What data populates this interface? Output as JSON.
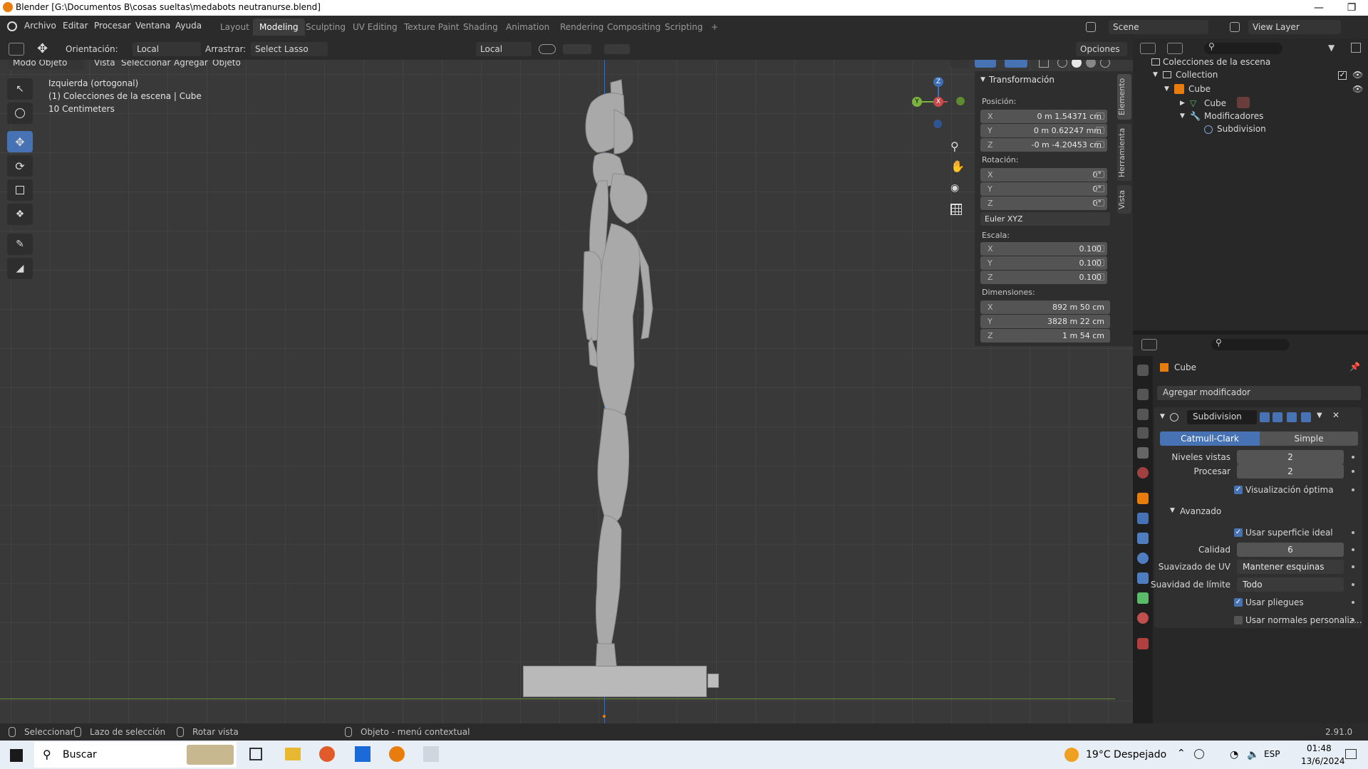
{
  "window": {
    "title": "Blender [G:\\Documentos B\\cosas sueltas\\medabots neutranurse.blend]",
    "minimize_icon": "minimize-icon",
    "maximize_icon": "restore-icon",
    "close_icon": "close-icon"
  },
  "menubar": {
    "items": [
      "Archivo",
      "Editar",
      "Procesar",
      "Ventana",
      "Ayuda"
    ],
    "workspaces": [
      "Layout",
      "Modeling",
      "Sculpting",
      "UV Editing",
      "Texture Paint",
      "Shading",
      "Animation",
      "Rendering",
      "Compositing",
      "Scripting"
    ],
    "active_workspace": "Modeling",
    "add_tab": "+",
    "scene": "Scene",
    "view_layer": "View Layer"
  },
  "tool_header": {
    "orientation_label": "Orientación:",
    "orientation_value": "Local",
    "drag_label": "Arrastrar:",
    "drag_value": "Select Lasso",
    "transform_pivot": "Local",
    "options": "Opciones"
  },
  "viewport_header": {
    "mode": "Modo Objeto",
    "items": [
      "Vista",
      "Seleccionar",
      "Agregar",
      "Objeto"
    ]
  },
  "viewport": {
    "view_name": "Izquierda (ortogonal)",
    "collection_info": "(1) Colecciones de la escena | Cube",
    "scale_info": "10 Centimeters",
    "gizmo": {
      "z": "Z",
      "y": "Y",
      "x": "X"
    }
  },
  "npanel": {
    "section": "Transformación",
    "position_label": "Posición:",
    "position": [
      {
        "axis": "X",
        "value": "0 m 1.54371 cm"
      },
      {
        "axis": "Y",
        "value": "0 m 0.62247 mm"
      },
      {
        "axis": "Z",
        "value": "-0 m -4.20453 cm"
      }
    ],
    "rotation_label": "Rotación:",
    "rotation": [
      {
        "axis": "X",
        "value": "0°"
      },
      {
        "axis": "Y",
        "value": "0°"
      },
      {
        "axis": "Z",
        "value": "0°"
      }
    ],
    "rotation_mode": "Euler XYZ",
    "scale_label": "Escala:",
    "scale": [
      {
        "axis": "X",
        "value": "0.100"
      },
      {
        "axis": "Y",
        "value": "0.100"
      },
      {
        "axis": "Z",
        "value": "0.100"
      }
    ],
    "dimensions_label": "Dimensiones:",
    "dimensions": [
      {
        "axis": "X",
        "value": "892 m 50 cm"
      },
      {
        "axis": "Y",
        "value": "3828 m 22 cm"
      },
      {
        "axis": "Z",
        "value": "1 m 54 cm"
      }
    ],
    "tabs": [
      "Elemento",
      "Herramienta",
      "Vista"
    ]
  },
  "outliner": {
    "root": "Colecciones de la escena",
    "collection": "Collection",
    "object": "Cube",
    "mesh": "Cube",
    "modifiers": "Modificadores",
    "modifier": "Subdivision"
  },
  "properties": {
    "object_name": "Cube",
    "add_modifier": "Agregar modificador",
    "modifier_name": "Subdivision",
    "algorithm_options": [
      "Catmull-Clark",
      "Simple"
    ],
    "active_algorithm": "Catmull-Clark",
    "levels_viewport_label": "Niveles vistas",
    "levels_viewport": "2",
    "render_label": "Procesar",
    "render": "2",
    "optimal_display": "Visualización óptima",
    "advanced": "Avanzado",
    "use_limit_surface": "Usar superficie ideal",
    "quality_label": "Calidad",
    "quality": "6",
    "uv_smooth_label": "Suavizado de UV",
    "uv_smooth": "Mantener esquinas",
    "boundary_smooth_label": "Suavidad de límite",
    "boundary_smooth": "Todo",
    "use_creases": "Usar pliegues",
    "use_custom_normals": "Usar normales personaliz..."
  },
  "statusbar": {
    "select": "Seleccionar",
    "lasso": "Lazo de selección",
    "rotate": "Rotar vista",
    "context": "Objeto - menú contextual",
    "version": "2.91.0"
  },
  "taskbar": {
    "search": "Buscar",
    "weather": "19°C  Despejado",
    "lang": "ESP",
    "time": "01:48",
    "date": "13/6/2024"
  },
  "colors": {
    "accent": "#4772b3",
    "viewport_bg": "#393939",
    "panel_bg": "#2e2e2e"
  }
}
